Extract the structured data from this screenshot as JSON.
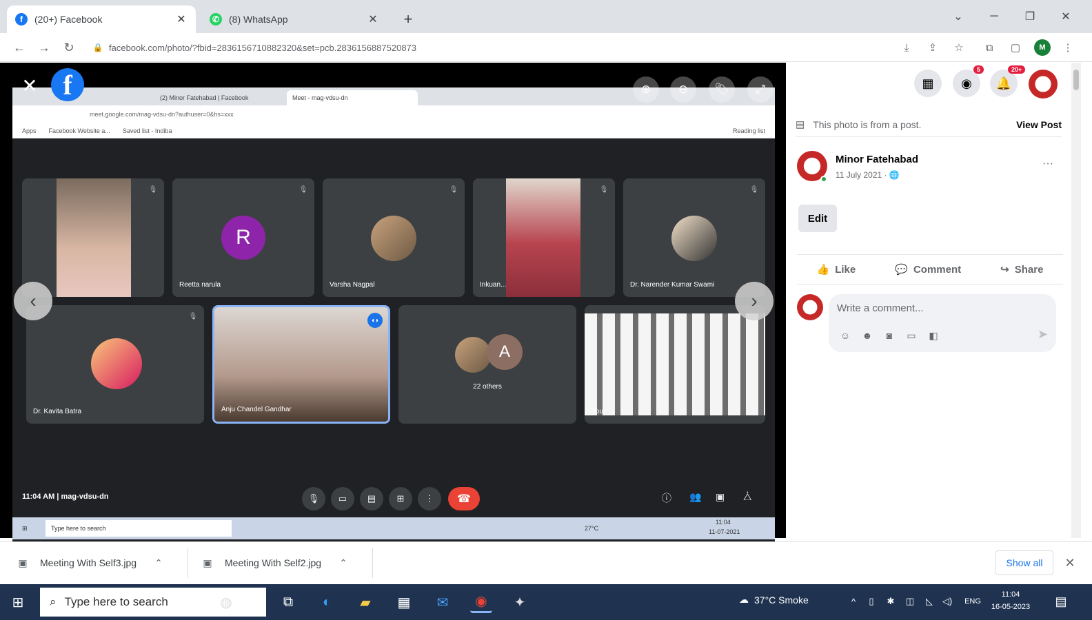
{
  "browser": {
    "tabs": [
      {
        "title": "(20+) Facebook",
        "active": true
      },
      {
        "title": "(8) WhatsApp",
        "active": false
      }
    ],
    "url": "facebook.com/photo/?fbid=2836156710882320&set=pcb.2836156887520873"
  },
  "viewer": {
    "logo_letter": "f",
    "inner_tabs": [
      "...",
      "(2) Minor Fatehabad | Facebook",
      "Meet - mag-vdsu-dn"
    ],
    "inner_url": "meet.google.com/mag-vdsu-dn?authuser=0&hs=xxx",
    "bookmarks": [
      "Apps",
      "Facebook Website a...",
      "Saved list - Indiba"
    ],
    "bookmarks_right": "Reading list",
    "participants_row1": [
      {
        "name": "...",
        "kind": "video",
        "letter": ""
      },
      {
        "name": "Reetta narula",
        "kind": "letter",
        "letter": "R"
      },
      {
        "name": "Varsha Nagpal",
        "kind": "avatar",
        "letter": ""
      },
      {
        "name": "Inkuan...",
        "kind": "video",
        "letter": ""
      },
      {
        "name": "Dr. Narender Kumar Swami",
        "kind": "avatar",
        "letter": ""
      }
    ],
    "participants_row2": [
      {
        "name": "Dr. Kavita Batra",
        "kind": "avatar",
        "letter": ""
      },
      {
        "name": "Anju Chandel Gandhar",
        "kind": "video",
        "letter": ""
      },
      {
        "name": "22 others",
        "kind": "letter",
        "letter": "A"
      },
      {
        "name": "You",
        "kind": "video",
        "letter": ""
      }
    ],
    "meet_time": "11:04 AM | mag-vdsu-dn",
    "inner_search": "Type here to search",
    "inner_weather": "27°C",
    "inner_clock": "11:04",
    "inner_date": "11-07-2021"
  },
  "panel": {
    "badges": {
      "messenger": "5",
      "notifications": "20+"
    },
    "from_post": "This photo is from a post.",
    "view_post": "View Post",
    "poster_name": "Minor Fatehabad",
    "poster_date": "11 July 2021 ·",
    "edit": "Edit",
    "like": "Like",
    "comment": "Comment",
    "share": "Share",
    "comment_placeholder": "Write a comment..."
  },
  "downloads": {
    "items": [
      "Meeting With Self3.jpg",
      "Meeting With Self2.jpg"
    ],
    "show_all": "Show all"
  },
  "taskbar": {
    "search": "Type here to search",
    "weather": "37°C Smoke",
    "lang": "ENG",
    "time": "11:04",
    "date": "16-05-2023"
  },
  "colors": {
    "facebook_blue": "#1877f2",
    "meet_end": "#ea4335",
    "taskbar": "#1f3351"
  },
  "icons": [
    "close-icon",
    "zoom-in-icon",
    "tag-icon",
    "fullscreen-icon",
    "menu-grid-icon",
    "messenger-icon",
    "bell-icon",
    "like-icon",
    "comment-icon",
    "share-icon"
  ]
}
